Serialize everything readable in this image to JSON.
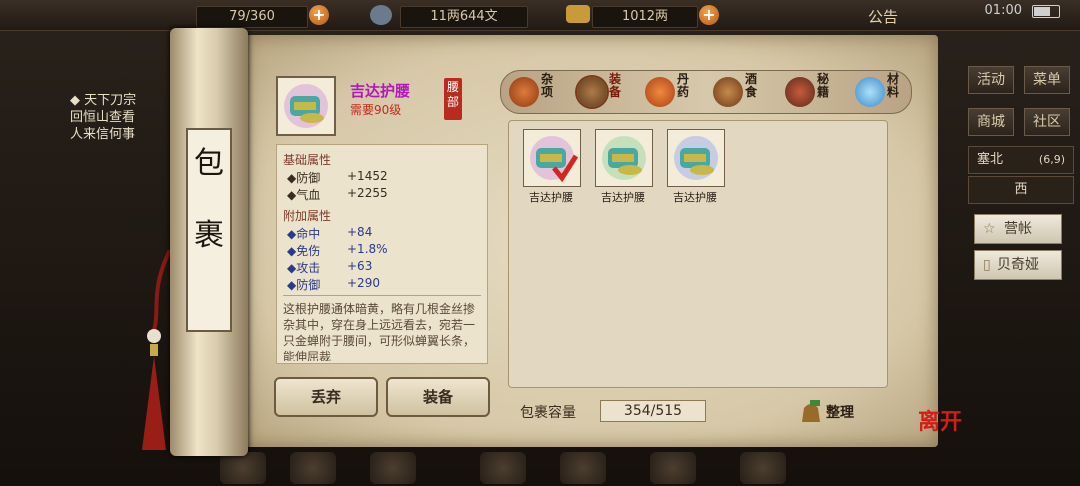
{
  "topbar": {
    "stamina": "79/360",
    "silver": "11两644文",
    "gold": "1012两",
    "notice": "公告",
    "time": "01:00"
  },
  "quest": {
    "title": "◆ 天下刀宗",
    "line1": "回恒山查看",
    "line2": "人来信何事"
  },
  "right_panel": {
    "activity": "活动",
    "menu": "菜单",
    "mall": "商城",
    "community": "社区",
    "location": "塞北",
    "coords": "(6,9)",
    "place": "西",
    "camp": "营帐",
    "npc": "贝奇娅"
  },
  "scroll": {
    "title": "包裹"
  },
  "item": {
    "name": "吉达护腰",
    "level_req": "需要90级",
    "slot": "腰部",
    "base_header": "基础属性",
    "base_attrs": [
      {
        "label": "◆防御",
        "value": "+1452"
      },
      {
        "label": "◆气血",
        "value": "+2255"
      }
    ],
    "extra_header": "附加属性",
    "extra_attrs": [
      {
        "label": "◆命中",
        "value": "+84"
      },
      {
        "label": "◆免伤",
        "value": "+1.8%"
      },
      {
        "label": "◆攻击",
        "value": "+63"
      },
      {
        "label": "◆防御",
        "value": "+290"
      }
    ],
    "description": "这根护腰通体暗黄，略有几根金丝掺杂其中，穿在身上远远看去，宛若一只金蝉附于腰间，可形似蝉翼长条，能伸屈裁"
  },
  "buttons": {
    "discard": "丢弃",
    "equip": "装备",
    "sort": "整理"
  },
  "tabs": [
    {
      "label": "杂项",
      "color": "#c9571e"
    },
    {
      "label": "装备",
      "color": "#8a4a2a"
    },
    {
      "label": "丹药",
      "color": "#d8541c"
    },
    {
      "label": "酒食",
      "color": "#9a5d2a"
    },
    {
      "label": "秘籍",
      "color": "#a44a2a"
    },
    {
      "label": "材料",
      "color": "#5aa8d8"
    }
  ],
  "grid_items": [
    {
      "name": "吉达护腰",
      "checked": true
    },
    {
      "name": "吉达护腰",
      "checked": false
    },
    {
      "name": "吉达护腰",
      "checked": false
    }
  ],
  "capacity": {
    "label": "包裹容量",
    "value": "354/515"
  },
  "leave": "离开"
}
